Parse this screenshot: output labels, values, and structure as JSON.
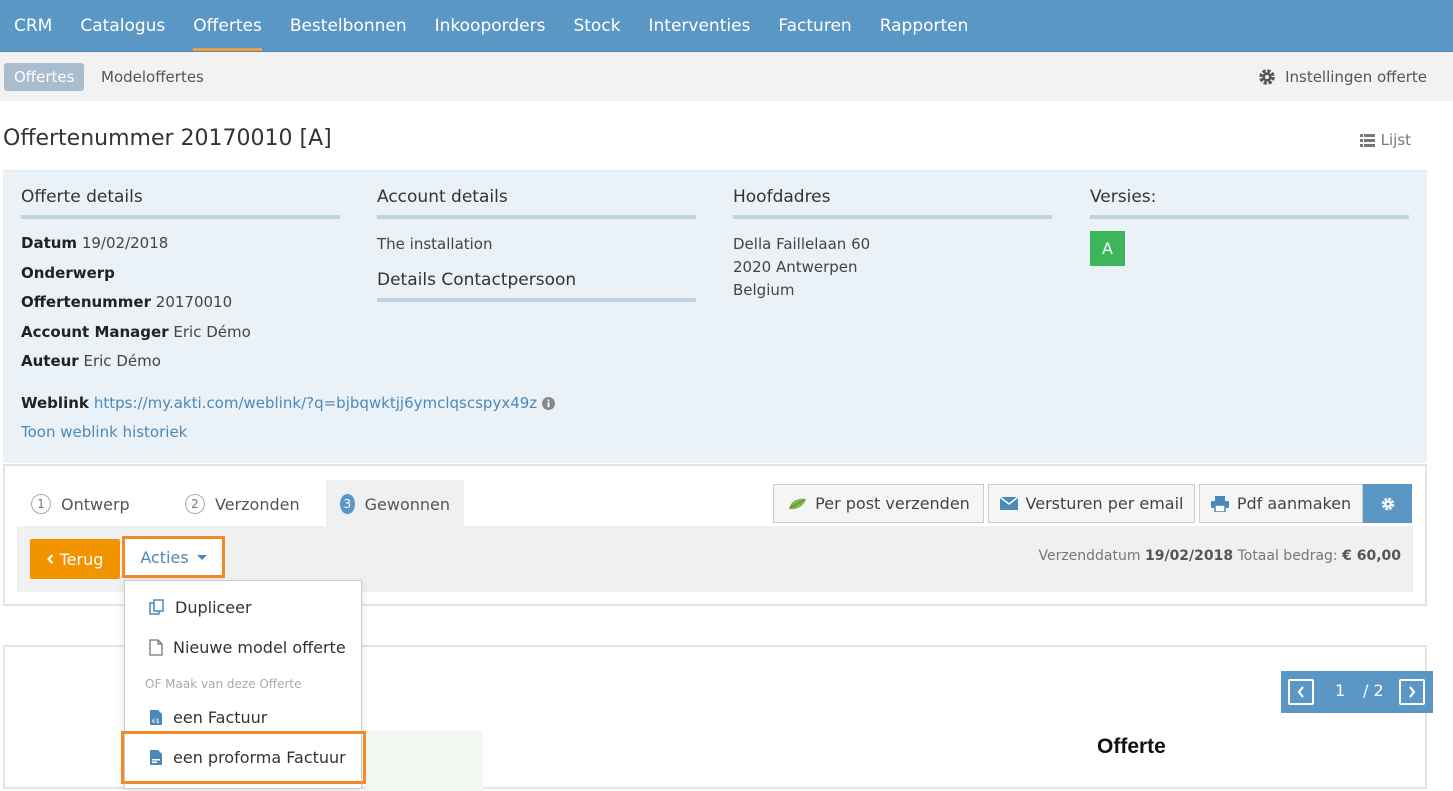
{
  "topnav": {
    "items": [
      {
        "label": "CRM"
      },
      {
        "label": "Catalogus"
      },
      {
        "label": "Offertes"
      },
      {
        "label": "Bestelbonnen"
      },
      {
        "label": "Inkooporders"
      },
      {
        "label": "Stock"
      },
      {
        "label": "Interventies"
      },
      {
        "label": "Facturen"
      },
      {
        "label": "Rapporten"
      }
    ],
    "active": "Offertes"
  },
  "subnav": {
    "active_label": "Offertes",
    "other_label": "Modeloffertes",
    "settings_label": "Instellingen offerte"
  },
  "page": {
    "title": "Offertenummer 20170010 [A]",
    "list_label": "Lijst"
  },
  "details": {
    "offerte": {
      "heading": "Offerte details",
      "datum_label": "Datum",
      "datum_value": "19/02/2018",
      "onderwerp_label": "Onderwerp",
      "nummer_label": "Offertenummer",
      "nummer_value": "20170010",
      "manager_label": "Account Manager",
      "manager_value": "Eric Démo",
      "auteur_label": "Auteur",
      "auteur_value": "Eric Démo"
    },
    "account": {
      "heading": "Account details",
      "name": "The installation",
      "contact_heading": "Details Contactpersoon"
    },
    "address": {
      "heading": "Hoofdadres",
      "line1": "Della Faillelaan 60",
      "line2": "2020 Antwerpen",
      "line3": "Belgium"
    },
    "versions": {
      "heading": "Versies:",
      "badge": "A"
    },
    "weblink_label": "Weblink",
    "weblink_url": "https://my.akti.com/weblink/?q=bjbqwktjj6ymclqscspyx49z",
    "history_label": "Toon weblink historiek"
  },
  "workflow": {
    "tabs": [
      {
        "num": "1",
        "label": "Ontwerp"
      },
      {
        "num": "2",
        "label": "Verzonden"
      },
      {
        "num": "3",
        "label": "Gewonnen"
      }
    ],
    "buttons": {
      "post": "Per post verzenden",
      "email": "Versturen per email",
      "pdf": "Pdf aanmaken"
    },
    "back_label": "Terug",
    "acties_label": "Acties",
    "send_date_label": "Verzenddatum",
    "send_date": "19/02/2018",
    "total_label": "Totaal bedrag:",
    "total": "€ 60,00"
  },
  "dropdown": {
    "duplicate": "Dupliceer",
    "new_model": "Nieuwe model offerte",
    "header": "OF Maak van deze Offerte",
    "invoice": "een Factuur",
    "proforma": "een proforma Factuur"
  },
  "preview": {
    "page_current": "1",
    "page_total": "/ 2",
    "doc_title": "Offerte"
  },
  "colors": {
    "nav": "#5b97c4",
    "accent": "#f29400",
    "highlight": "#f28a2c",
    "badge": "#3cb55b"
  }
}
